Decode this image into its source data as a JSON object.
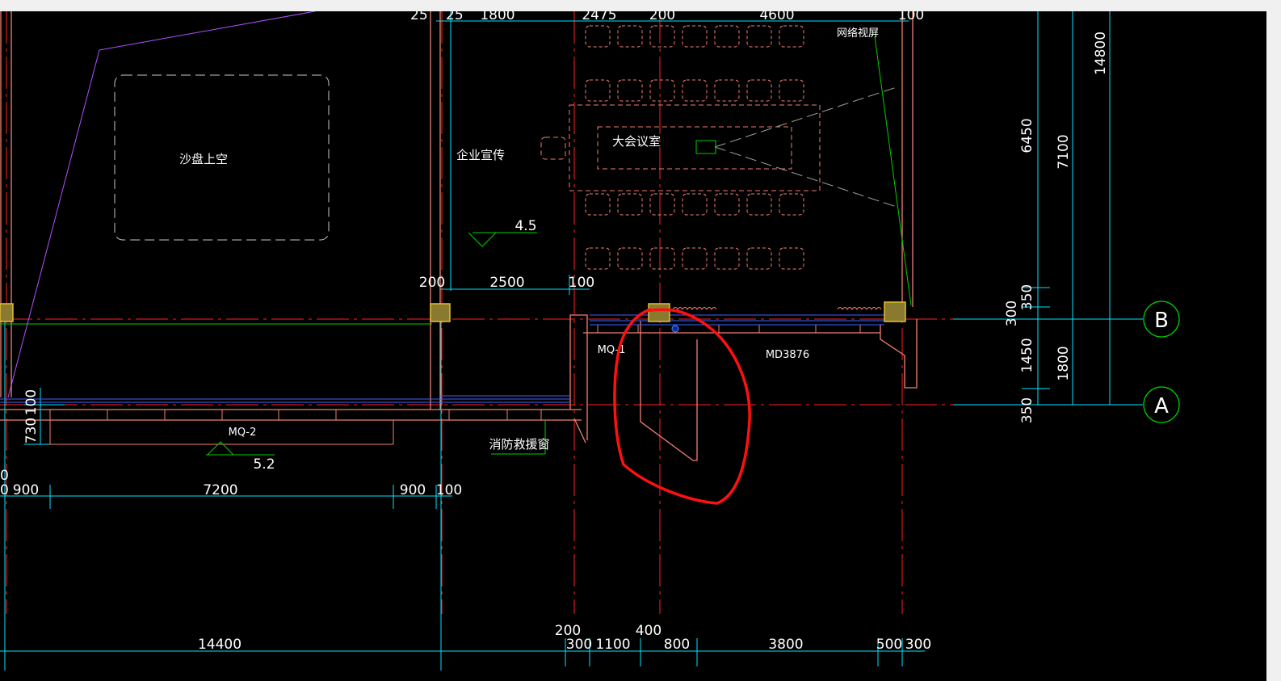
{
  "window": {
    "title_bar": "",
    "scrollbar": "vertical"
  },
  "labels": {
    "sand_table_void": "沙盘上空",
    "corporate_promo": "企业宣传",
    "big_meeting_room": "大会议室",
    "network_video": "网络视屏",
    "fire_rescue_window": "消防救援窗",
    "door_mq1": "MQ-1",
    "door_mq2": "MQ-2",
    "door_md3876": "MD3876"
  },
  "elevations": {
    "upper": "4.5",
    "lower": "5.2"
  },
  "grid_axes": {
    "b": "B",
    "a": "A"
  },
  "dims_top": {
    "d1": "25",
    "d2": "25",
    "d3": "1800",
    "d4": "2475",
    "d5": "200",
    "d6": "4600",
    "d7": "100"
  },
  "dims_mid": {
    "d1": "200",
    "d2": "2500",
    "d3": "100"
  },
  "dims_lower": {
    "d0": "0",
    "d1": "0",
    "d2": "900",
    "d3": "7200",
    "d4": "900",
    "d5": "100"
  },
  "dims_left": {
    "d1": "100",
    "d2": "730"
  },
  "dims_bottom": {
    "d1": "14400",
    "d2": "200",
    "d3": "300",
    "d4": "1100",
    "d5": "400",
    "d6": "800",
    "d7": "3800",
    "d8": "500",
    "d9": "300"
  },
  "dims_right": {
    "r1": "6450",
    "r2": "350",
    "r3": "300",
    "r4": "1450",
    "r5": "350",
    "r6": "7100",
    "r7": "1800",
    "r8": "14800"
  },
  "colors": {
    "background": "#000000",
    "wall": "#f08070",
    "axis": "#ff2020",
    "dimension": "#00e5ff",
    "annotation": "#00d000",
    "window_line": "#4060ff",
    "column": "#e0c030",
    "markup": "#ff1010",
    "void_line": "#b050ff"
  },
  "annotation_markup": {
    "shape": "red-freehand-circle"
  }
}
